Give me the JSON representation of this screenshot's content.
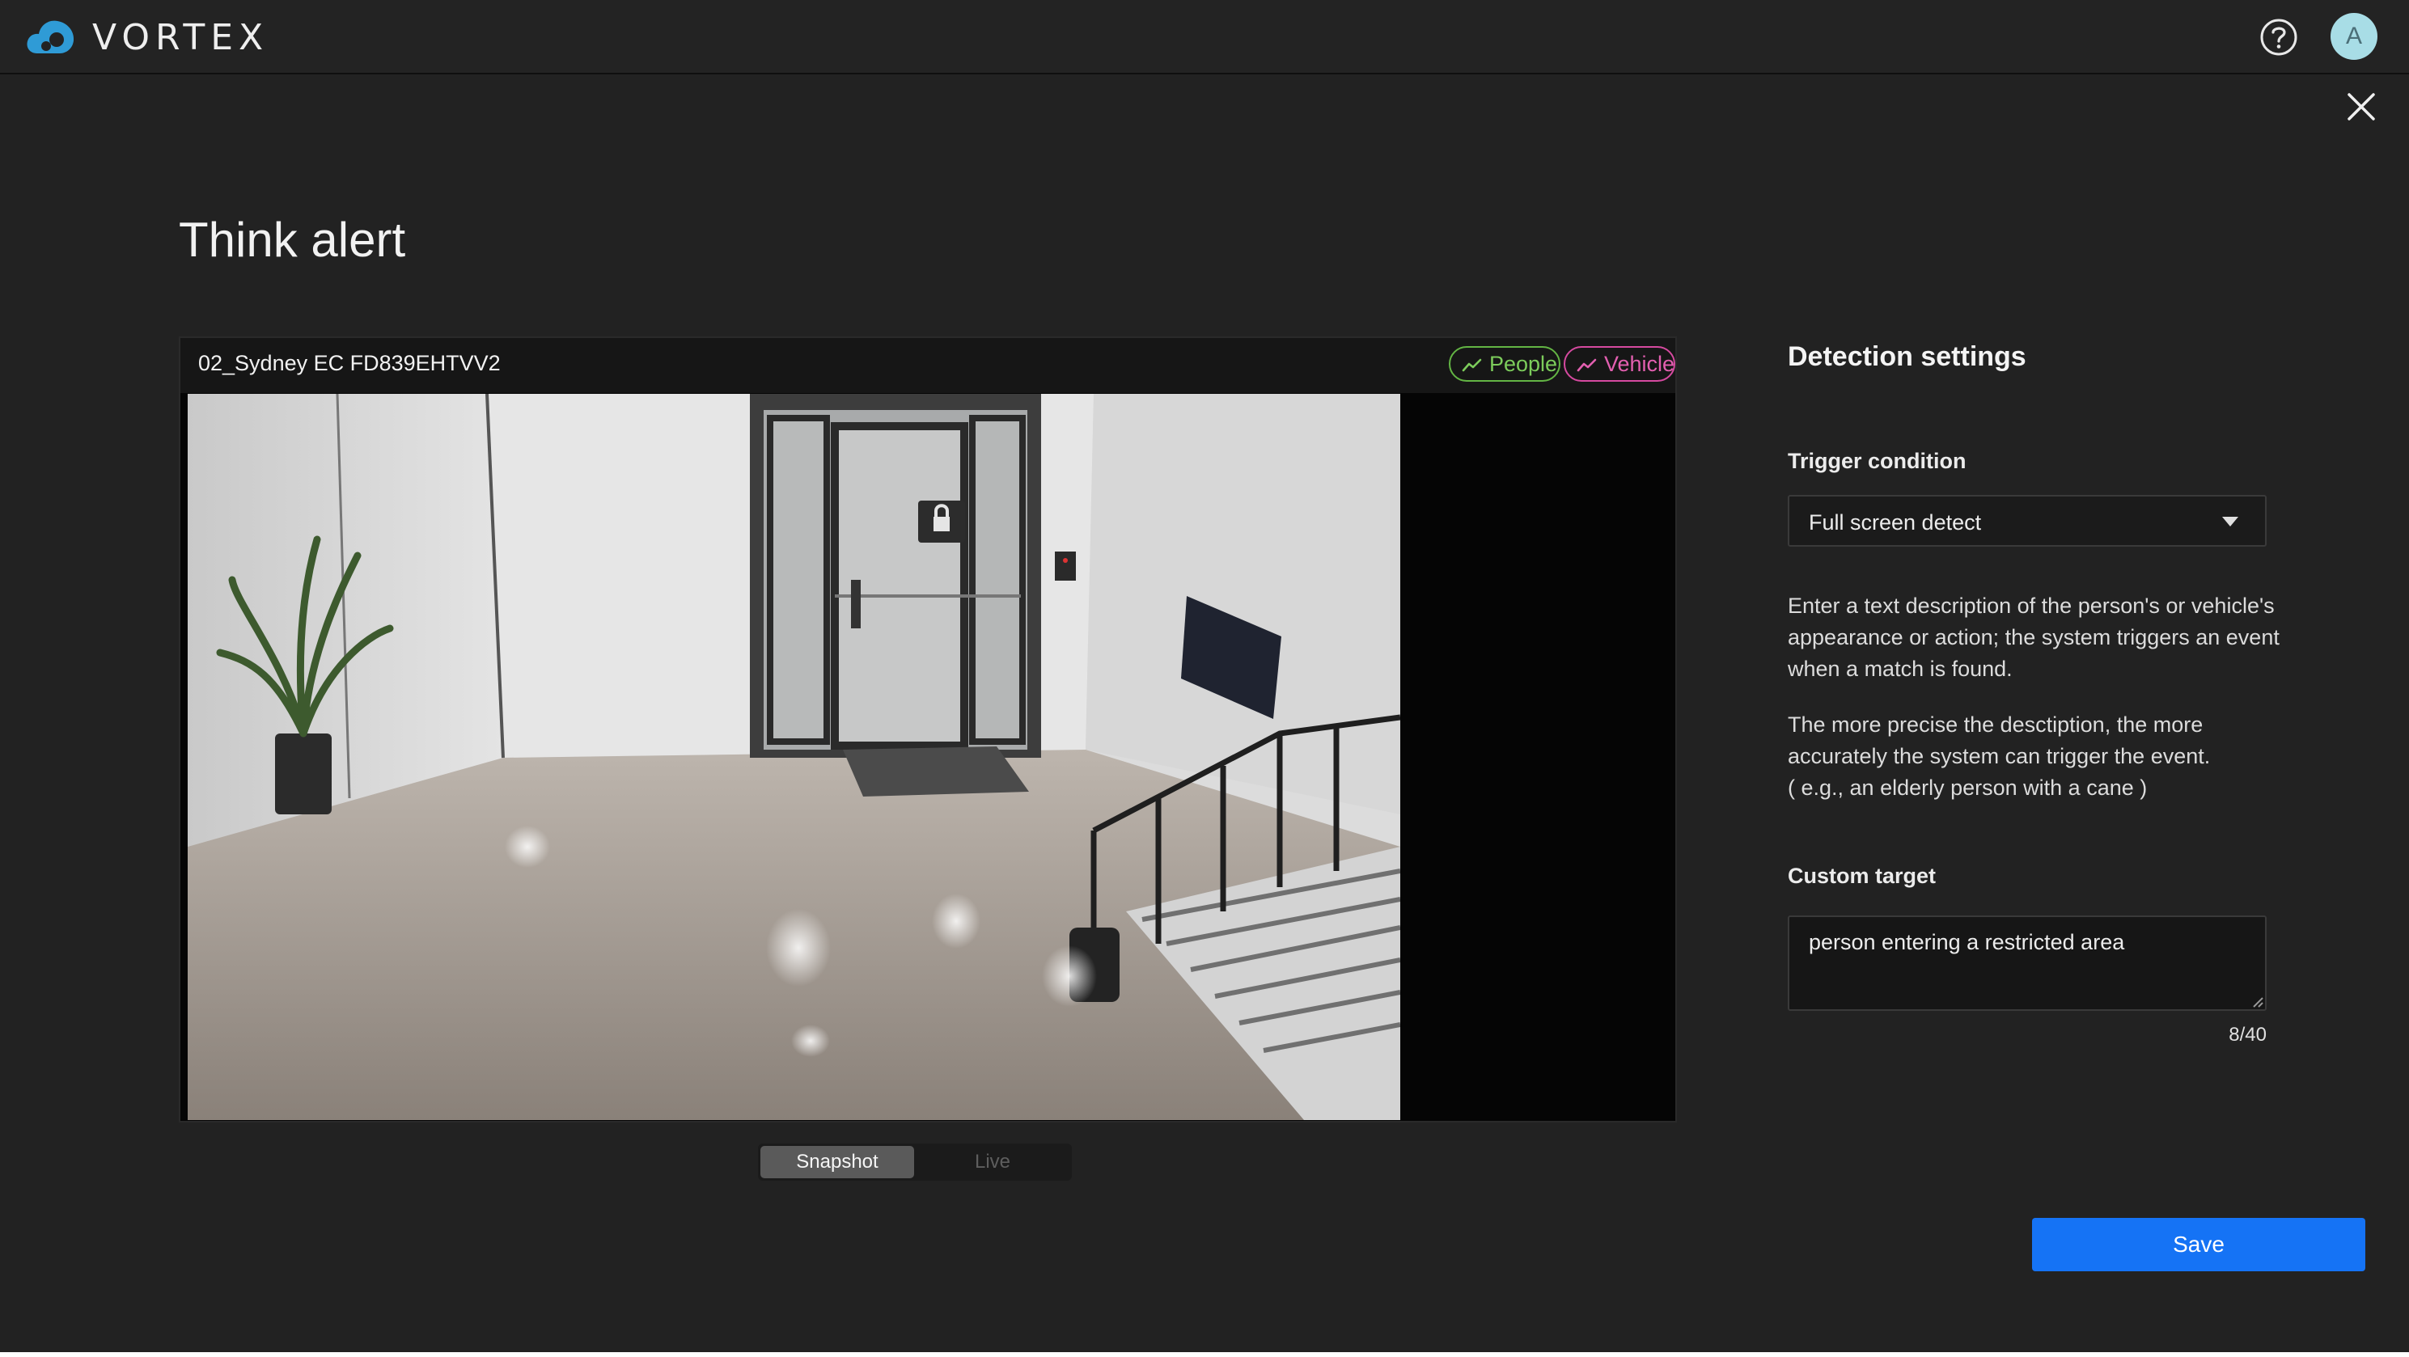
{
  "app": {
    "name": "VORTEX",
    "user_initial": "A"
  },
  "page": {
    "title": "Think alert"
  },
  "camera": {
    "name": "02_Sydney EC FD839EHTVV2",
    "tags": [
      {
        "label": "People",
        "color": "#63b544",
        "icon": "trend-icon"
      },
      {
        "label": "Vehicle",
        "color": "#d64aa0",
        "icon": "trend-icon"
      }
    ],
    "view_modes": [
      "Snapshot",
      "Live"
    ],
    "selected_view": "Snapshot"
  },
  "settings": {
    "title": "Detection settings",
    "trigger_label": "Trigger condition",
    "trigger_value": "Full screen detect",
    "description_1": "Enter a text description of the person's or vehicle's appearance or action; the system triggers an event when a match is found.",
    "description_2": "The more precise the desctiption, the more accurately the system can trigger the event.",
    "description_example": "( e.g., an elderly person with a cane )",
    "custom_target_label": "Custom target",
    "custom_target_value": "person entering a restricted area",
    "char_count": "8/40",
    "save_label": "Save"
  },
  "colors": {
    "accent": "#1573f5",
    "people": "#63b544",
    "vehicle": "#d64aa0",
    "avatar": "#a8dde6"
  }
}
